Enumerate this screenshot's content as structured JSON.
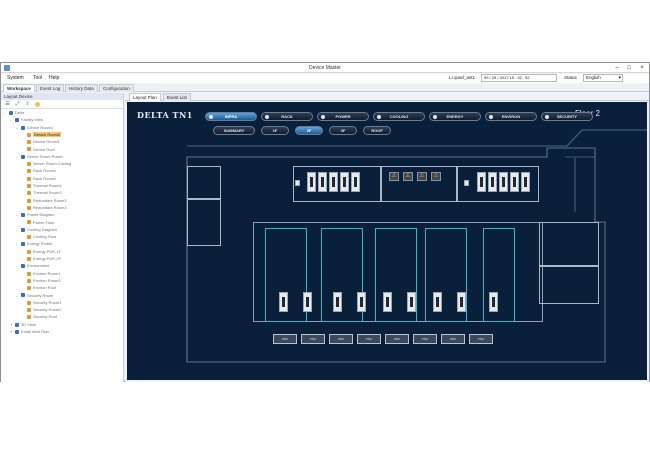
{
  "window": {
    "title": "Device Master"
  },
  "menu": {
    "items": [
      "System",
      "Tool",
      "Help"
    ]
  },
  "header": {
    "user": "LI quarl_ast1",
    "date": "09 / 25 / 2017   15 : 32 : 52",
    "status_label": "Status",
    "language": "English"
  },
  "tabs": [
    "Workspace",
    "Event Log",
    "History Data",
    "Configuration"
  ],
  "left_panel": {
    "title": "Layout Device",
    "tree": [
      {
        "label": "Delta",
        "level": 0,
        "icon": "site",
        "expand": "-"
      },
      {
        "label": "Facility View",
        "level": 1,
        "icon": "site",
        "expand": "-"
      },
      {
        "label": "Device Room1",
        "level": 2,
        "icon": "room",
        "expand": "-"
      },
      {
        "label": "Device Room2",
        "level": 3,
        "icon": "orange",
        "selected": true
      },
      {
        "label": "Device Room3",
        "level": 3,
        "icon": "orange"
      },
      {
        "label": "Device Roof",
        "level": 3,
        "icon": "orange"
      },
      {
        "label": "Server Room Power",
        "level": 2,
        "icon": "room",
        "expand": "-"
      },
      {
        "label": "Server Room Cooling",
        "level": 3,
        "icon": "orange"
      },
      {
        "label": "Rack Room1",
        "level": 3,
        "icon": "orange"
      },
      {
        "label": "Rack Room2",
        "level": 3,
        "icon": "orange"
      },
      {
        "label": "Thermal Room1",
        "level": 3,
        "icon": "orange"
      },
      {
        "label": "Thermal Room2",
        "level": 3,
        "icon": "orange"
      },
      {
        "label": "Redundant Room2",
        "level": 3,
        "icon": "orange"
      },
      {
        "label": "Redundant Room3",
        "level": 3,
        "icon": "orange"
      },
      {
        "label": "Power Diagram",
        "level": 2,
        "icon": "room",
        "expand": "-"
      },
      {
        "label": "Power Flow",
        "level": 3,
        "icon": "orange"
      },
      {
        "label": "Cooling Diagram",
        "level": 2,
        "icon": "room",
        "expand": "-"
      },
      {
        "label": "Cooling Flow",
        "level": 3,
        "icon": "orange"
      },
      {
        "label": "Energy Profile",
        "level": 2,
        "icon": "room",
        "expand": "-"
      },
      {
        "label": "Energy PUE-1F",
        "level": 3,
        "icon": "orange"
      },
      {
        "label": "Energy PUE-2F",
        "level": 3,
        "icon": "orange"
      },
      {
        "label": "Environment",
        "level": 2,
        "icon": "room",
        "expand": "-"
      },
      {
        "label": "Environ Room1",
        "level": 3,
        "icon": "orange"
      },
      {
        "label": "Environ Room2",
        "level": 3,
        "icon": "orange"
      },
      {
        "label": "Environ Roof",
        "level": 3,
        "icon": "orange"
      },
      {
        "label": "Security Room",
        "level": 2,
        "icon": "room",
        "expand": "-"
      },
      {
        "label": "Security Room1",
        "level": 3,
        "icon": "orange"
      },
      {
        "label": "Security Room2",
        "level": 3,
        "icon": "orange"
      },
      {
        "label": "Security Roof",
        "level": 3,
        "icon": "orange"
      },
      {
        "label": "3D View",
        "level": 1,
        "icon": "site",
        "expand": "+"
      },
      {
        "label": "Email Alert Rule",
        "level": 1,
        "icon": "site",
        "expand": "+"
      }
    ]
  },
  "right_panel": {
    "tabs": [
      "Layout Plan",
      "Event List"
    ]
  },
  "canvas": {
    "brand": "DELTA TN1",
    "floor_label": "Floor 2",
    "categories": [
      "INFRA",
      "RACK",
      "POWER",
      "COOLING",
      "ENERGY",
      "ENVIRON",
      "SECURITY"
    ],
    "active_category": "INFRA",
    "floors": [
      "SUMMARY",
      "1F",
      "2F",
      "3F",
      "ROOF"
    ],
    "active_floor": "2F",
    "pdu_label": "PDU"
  }
}
